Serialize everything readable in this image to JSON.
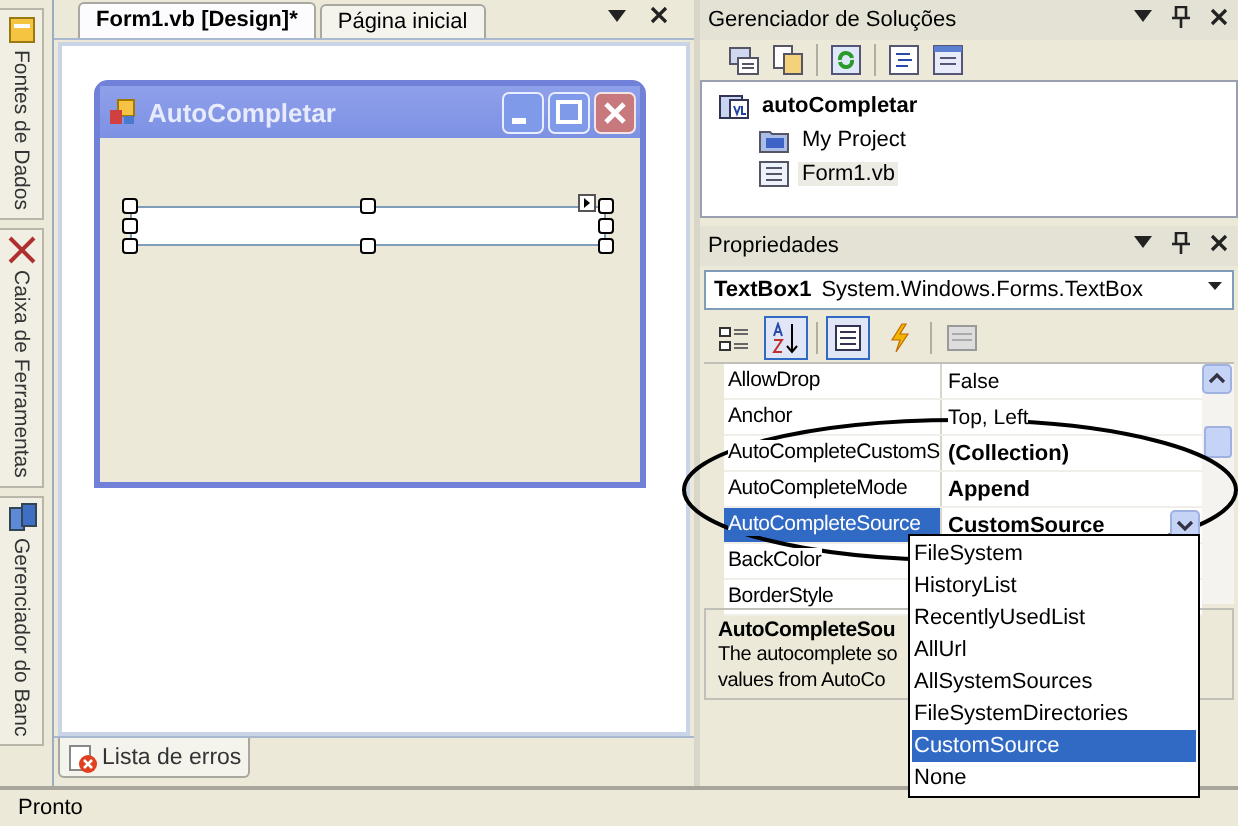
{
  "side_tabs": [
    {
      "label": "Fontes de Dados",
      "kind": "data"
    },
    {
      "label": "Caixa de Ferramentas",
      "kind": "tools"
    },
    {
      "label": "Gerenciador do Banc",
      "kind": "server"
    }
  ],
  "editor": {
    "tabs": [
      {
        "label": "Form1.vb [Design]*",
        "selected": true
      },
      {
        "label": "Página inicial",
        "selected": false
      }
    ],
    "form": {
      "title": "AutoCompletar"
    }
  },
  "bottom_tabs": [
    {
      "label": "Lista de erros"
    }
  ],
  "solution_explorer": {
    "title": "Gerenciador de Soluções",
    "tree": [
      {
        "label": "autoCompletar",
        "kind": "project",
        "selected": false,
        "children": [
          {
            "label": "My Project",
            "kind": "folder",
            "selected": false
          },
          {
            "label": "Form1.vb",
            "kind": "form",
            "selected": true
          }
        ]
      }
    ]
  },
  "properties": {
    "title": "Propriedades",
    "object": {
      "name": "TextBox1",
      "type": "System.Windows.Forms.TextBox"
    },
    "toolbar": [
      {
        "kind": "categorized",
        "selected": false
      },
      {
        "kind": "alphabetical",
        "selected": true
      },
      {
        "kind": "properties",
        "selected": true
      },
      {
        "kind": "events",
        "selected": false
      },
      {
        "kind": "pages",
        "selected": false
      }
    ],
    "rows": [
      {
        "name": "AllowDrop",
        "value": "False",
        "modified": false,
        "selected": false
      },
      {
        "name": "Anchor",
        "value": "Top, Left",
        "modified": false,
        "selected": false
      },
      {
        "name": "AutoCompleteCustomS",
        "value": "(Collection)",
        "modified": true,
        "selected": false
      },
      {
        "name": "AutoCompleteMode",
        "value": "Append",
        "modified": true,
        "selected": false
      },
      {
        "name": "AutoCompleteSource",
        "value": "CustomSource",
        "modified": true,
        "selected": true
      },
      {
        "name": "BackColor",
        "selected": false
      },
      {
        "name": "BorderStyle",
        "selected": false
      }
    ],
    "dropdown": {
      "items": [
        {
          "label": "FileSystem",
          "selected": false
        },
        {
          "label": "HistoryList",
          "selected": false
        },
        {
          "label": "RecentlyUsedList",
          "selected": false
        },
        {
          "label": "AllUrl",
          "selected": false
        },
        {
          "label": "AllSystemSources",
          "selected": false
        },
        {
          "label": "FileSystemDirectories",
          "selected": false
        },
        {
          "label": "CustomSource",
          "selected": true
        },
        {
          "label": "None",
          "selected": false
        }
      ]
    },
    "description": {
      "title": "AutoCompleteSou",
      "lines": [
        "The autocomplete so",
        "values from AutoCo"
      ]
    }
  },
  "status_bar": {
    "text": "Pronto"
  }
}
